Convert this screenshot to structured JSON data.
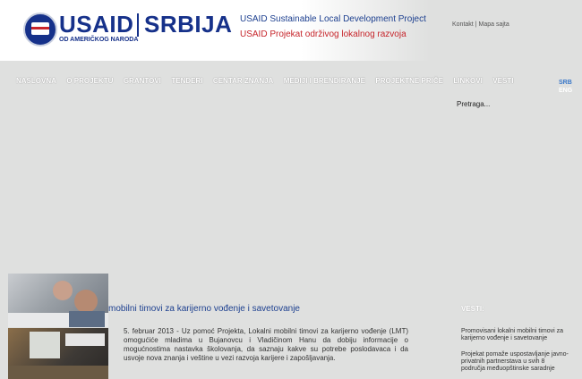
{
  "header": {
    "logo_usaid": "USAID",
    "logo_srbija": "SRBIJA",
    "logo_subtitle": "OD AMERIČKOG NARODA",
    "project_title_en": "USAID Sustainable Local Development Project",
    "project_title_sr": "USAID Projekat održivog lokalnog razvoja",
    "util_links": {
      "contact": "Kontakt",
      "separator": "|",
      "sitemap": "Mapa sajta"
    },
    "colors": {
      "brand_blue": "#16318a",
      "accent_red": "#c6242a"
    }
  },
  "nav": {
    "items": [
      "NASLOVNA",
      "O PROJEKTU",
      "GRANTOVI",
      "TENDERI",
      "CENTAR ZNANJA",
      "MEDIJI I BRENDIRANJE",
      "PROJEKTNE PRIČE",
      "LINKOVI",
      "VESTI"
    ]
  },
  "languages": {
    "srb": "SRB",
    "eng": "ENG"
  },
  "search": {
    "placeholder": "Pretraga..."
  },
  "article": {
    "title": "mobilni timovi za karijerno vođenje i savetovanje",
    "body": "5. februar 2013 - Uz pomoć Projekta, Lokalni mobilni timovi za karijerno vođenje (LMT) omogućiće mladima u Bujanovcu i Vladičinom Hanu da dobiju informacije o mogućnostima nastavka školovanja, da saznaju kakve su potrebe poslodavaca i da usvoje nova znanja i veštine u vezi razvoja karijere i zapošljavanja."
  },
  "news": {
    "heading": "VESTI:",
    "items": [
      "Promovisani lokalni mobilni timovi za karijerno vođenje i savetovanje",
      "Projekat pomaže uspostavljanje javno-privatnih partnerstava u svih 8 područja međuopštinske saradnje"
    ]
  }
}
